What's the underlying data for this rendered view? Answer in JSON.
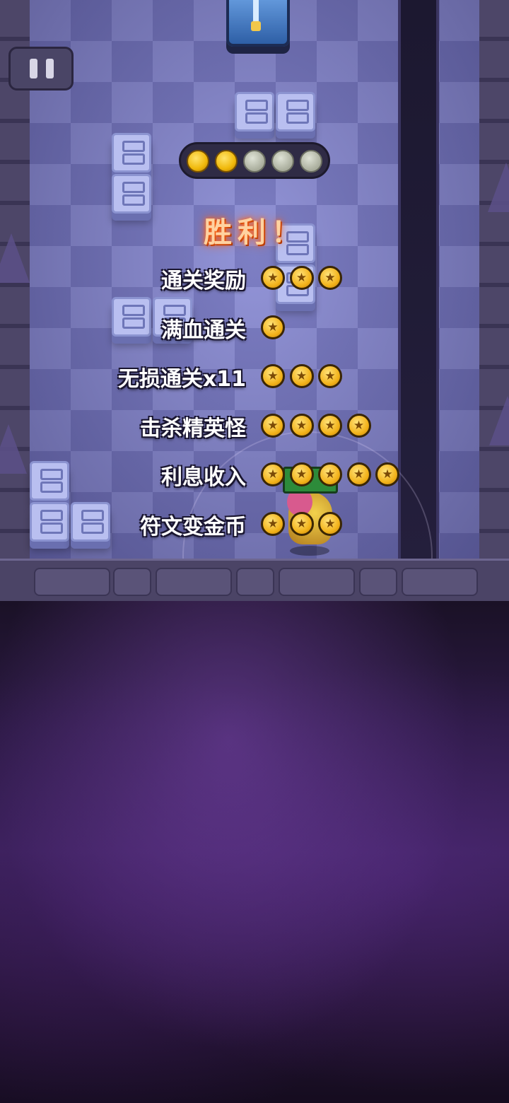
{
  "hud": {
    "pause_icon": "pause-icon",
    "level_progress": {
      "filled": 2,
      "total": 5
    }
  },
  "results": {
    "title": "胜利！",
    "rows": [
      {
        "label": "通关奖励",
        "coins": 3
      },
      {
        "label": "满血通关",
        "coins": 1
      },
      {
        "label": "无损通关x11",
        "coins": 3
      },
      {
        "label": "击杀精英怪",
        "coins": 4
      },
      {
        "label": "利息收入",
        "coins": 5
      },
      {
        "label": "符文变金币",
        "coins": 3
      }
    ]
  },
  "colors": {
    "floor": "#8d8fd6",
    "victory_glow": "#ff6a1a",
    "coin_gold": "#f2b21a",
    "void_purple": "#3a2358"
  }
}
